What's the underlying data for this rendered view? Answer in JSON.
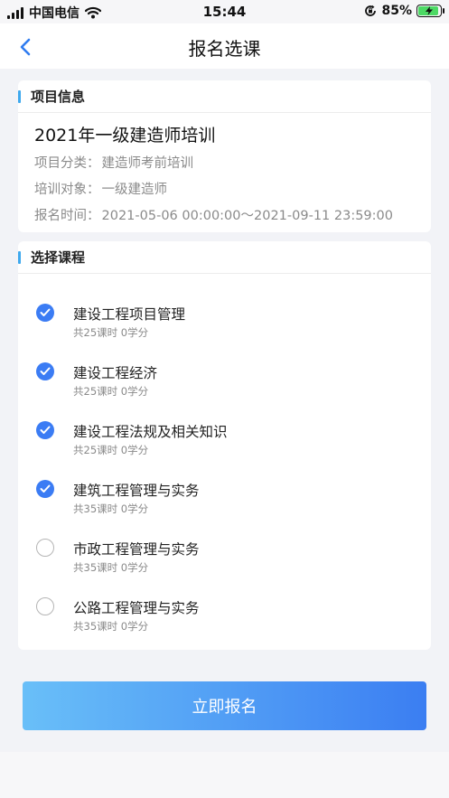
{
  "status_bar": {
    "carrier": "中国电信",
    "time": "15:44",
    "battery_percent": "85%",
    "icons": [
      "signal-icon",
      "wifi-icon",
      "screen-lock-icon",
      "battery-charging-icon"
    ]
  },
  "nav": {
    "title": "报名选课",
    "back_icon": "chevron-left-icon"
  },
  "project_info": {
    "section_title": "项目信息",
    "name": "2021年一级建造师培训",
    "rows": [
      {
        "label": "项目分类：",
        "value": "建造师考前培训"
      },
      {
        "label": "培训对象：",
        "value": "一级建造师"
      },
      {
        "label": "报名时间：",
        "value": "2021-05-06 00:00:00～2021-09-11 23:59:00"
      }
    ]
  },
  "course_section": {
    "section_title": "选择课程",
    "courses": [
      {
        "name": "建设工程项目管理",
        "meta": "共25课时 0学分",
        "checked": true
      },
      {
        "name": "建设工程经济",
        "meta": "共25课时 0学分",
        "checked": true
      },
      {
        "name": "建设工程法规及相关知识",
        "meta": "共25课时 0学分",
        "checked": true
      },
      {
        "name": "建筑工程管理与实务",
        "meta": "共35课时 0学分",
        "checked": true
      },
      {
        "name": "市政工程管理与实务",
        "meta": "共35课时 0学分",
        "checked": false
      },
      {
        "name": "公路工程管理与实务",
        "meta": "共35课时 0学分",
        "checked": false
      }
    ]
  },
  "submit": {
    "label": "立即报名"
  },
  "colors": {
    "accent": "#3b7cf4",
    "section_bar": "#3fa9ee",
    "button_gradient_start": "#69bff8",
    "button_gradient_end": "#3b7ef2"
  }
}
